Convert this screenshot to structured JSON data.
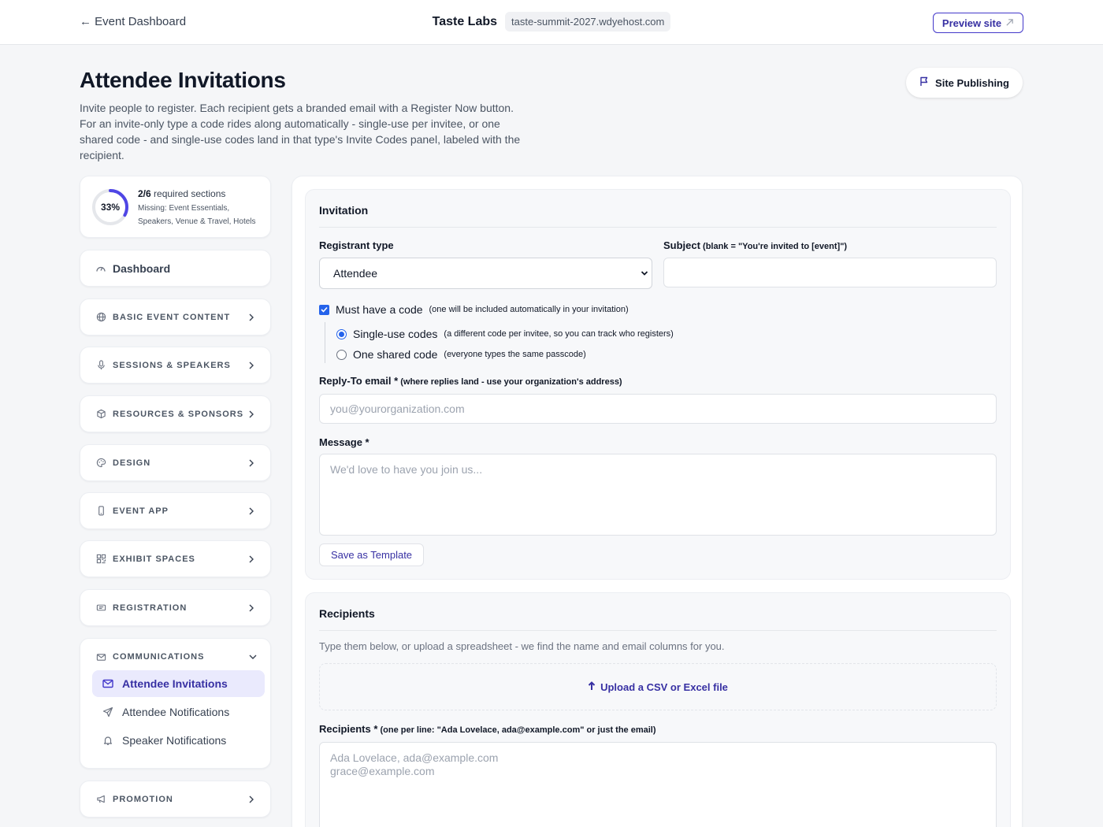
{
  "topbar": {
    "back_label": "← Event Dashboard",
    "brand": "Taste Labs",
    "domain": "taste-summit-2027.wdyehost.com",
    "preview_label": "Preview site"
  },
  "header": {
    "title": "Attendee Invitations",
    "description": "Invite people to register. Each recipient gets a branded email with a Register Now button. For an invite-only type a code rides along automatically - single-use per invitee, or one shared code - and single-use codes land in that type's Invite Codes panel, labeled with the recipient.",
    "publish_label": "Site Publishing"
  },
  "progress": {
    "percent_label": "33%",
    "percent": 0.33,
    "count": "2/6",
    "count_suffix": " required sections",
    "missing": "Missing: Event Essentials, Speakers, Venue & Travel, Hotels"
  },
  "sidebar": {
    "dashboard": "Dashboard",
    "items": [
      {
        "label": "BASIC EVENT CONTENT",
        "icon": "globe-icon"
      },
      {
        "label": "SESSIONS & SPEAKERS",
        "icon": "microphone-icon"
      },
      {
        "label": "RESOURCES & SPONSORS",
        "icon": "box-icon"
      },
      {
        "label": "DESIGN",
        "icon": "palette-icon"
      },
      {
        "label": "EVENT APP",
        "icon": "phone-icon"
      },
      {
        "label": "EXHIBIT SPACES",
        "icon": "grid-icon"
      },
      {
        "label": "REGISTRATION",
        "icon": "ticket-icon"
      }
    ],
    "communications": {
      "label": "COMMUNICATIONS",
      "items": [
        {
          "label": "Attendee Invitations",
          "active": true
        },
        {
          "label": "Attendee Notifications",
          "active": false
        },
        {
          "label": "Speaker Notifications",
          "active": false
        }
      ]
    },
    "promotion": "PROMOTION"
  },
  "invitation": {
    "title": "Invitation",
    "registrant_label": "Registrant type",
    "registrant_value": "Attendee",
    "subject_label": "Subject",
    "subject_hint": " (blank = \"You're invited to [event]\")",
    "subject_value": "",
    "must_code_label": "Must have a code",
    "must_code_hint": "(one will be included automatically in your invitation)",
    "single_label": "Single-use codes",
    "single_hint": "(a different code per invitee, so you can track who registers)",
    "shared_label": "One shared code",
    "shared_hint": "(everyone types the same passcode)",
    "reply_label": "Reply-To email *",
    "reply_hint": " (where replies land - use your organization's address)",
    "reply_placeholder": "you@yourorganization.com",
    "message_label": "Message *",
    "message_placeholder": "We'd love to have you join us...",
    "template_label": "Save as Template"
  },
  "recipients": {
    "title": "Recipients",
    "subtitle": "Type them below, or upload a spreadsheet - we find the name and email columns for you.",
    "upload_label": "Upload a CSV or Excel file",
    "label": "Recipients *",
    "hint": " (one per line: \"Ada Lovelace, ada@example.com\" or just the email)",
    "placeholder": "Ada Lovelace, ada@example.com\ngrace@example.com"
  },
  "colors": {
    "accent": "#3730a3",
    "ring": "#4f46e5",
    "checkbox": "#2563eb"
  }
}
